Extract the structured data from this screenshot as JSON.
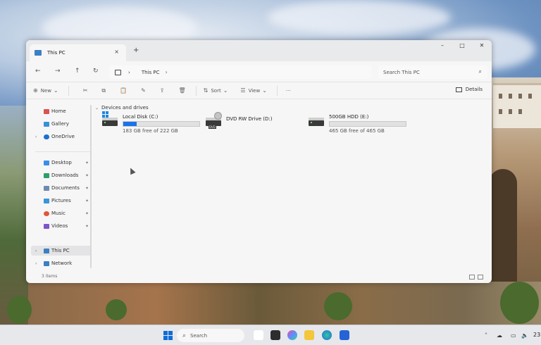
{
  "window": {
    "tab_title": "This PC",
    "tab_close": "×",
    "new_tab": "+",
    "controls": {
      "minimize": "–",
      "maximize": "□",
      "close": "✕"
    }
  },
  "nav": {
    "back": "←",
    "forward": "→",
    "up": "↑",
    "refresh": "↻",
    "expand": "›"
  },
  "address": {
    "crumb": "This PC",
    "sep_glyph": "›"
  },
  "search": {
    "placeholder": "Search This PC",
    "icon": "⌕"
  },
  "commands": {
    "new_label": "New",
    "sort_label": "Sort",
    "view_label": "View",
    "more_label": "···",
    "details_label": "Details",
    "icons": [
      "cut-icon",
      "copy-icon",
      "paste-icon",
      "rename-icon",
      "share-icon",
      "delete-icon"
    ],
    "glyphs": [
      "✂",
      "⧉",
      "📋",
      "✎",
      "⇪",
      "🗑"
    ],
    "dropdown_glyph": "⌄"
  },
  "sidebar": {
    "items": [
      {
        "label": "Home",
        "icon": "home-icon",
        "color": "#d9534f"
      },
      {
        "label": "Gallery",
        "icon": "gallery-icon",
        "color": "#3b8fd9"
      },
      {
        "label": "OneDrive",
        "icon": "cloud-icon",
        "color": "#1e6fd1"
      },
      {
        "label": "Desktop",
        "icon": "desktop-icon",
        "color": "#3a8ee6"
      },
      {
        "label": "Downloads",
        "icon": "download-icon",
        "color": "#2aa06c"
      },
      {
        "label": "Documents",
        "icon": "documents-icon",
        "color": "#6f8ab0"
      },
      {
        "label": "Pictures",
        "icon": "pictures-icon",
        "color": "#3c95d8"
      },
      {
        "label": "Music",
        "icon": "music-icon",
        "color": "#e0573a"
      },
      {
        "label": "Videos",
        "icon": "videos-icon",
        "color": "#7d56c8"
      },
      {
        "label": "This PC",
        "icon": "pc-icon",
        "color": "#3b7fc4"
      },
      {
        "label": "Network",
        "icon": "network-icon",
        "color": "#3b7fc4"
      }
    ],
    "pin_glyph": "📌"
  },
  "content": {
    "group_title": "Devices and drives",
    "chevron": "⌄",
    "drives": [
      {
        "name": "Local Disk (C:)",
        "free": "183 GB free of 222 GB",
        "used_fraction": 0.18,
        "icon": "windows-drive-icon"
      },
      {
        "name": "DVD RW Drive (D:)",
        "free": "",
        "used_fraction": null,
        "icon": "dvd-drive-icon",
        "badge": "DVD"
      },
      {
        "name": "500GB HDD (E:)",
        "free": "465 GB free of 465 GB",
        "used_fraction": 0.0,
        "icon": "hdd-icon"
      }
    ]
  },
  "status": {
    "items_count": "3 items"
  },
  "taskbar": {
    "search_label": "Search",
    "clock": "23"
  },
  "colors": {
    "accent": "#1a73e8",
    "window_bg": "#f6f6f6"
  }
}
